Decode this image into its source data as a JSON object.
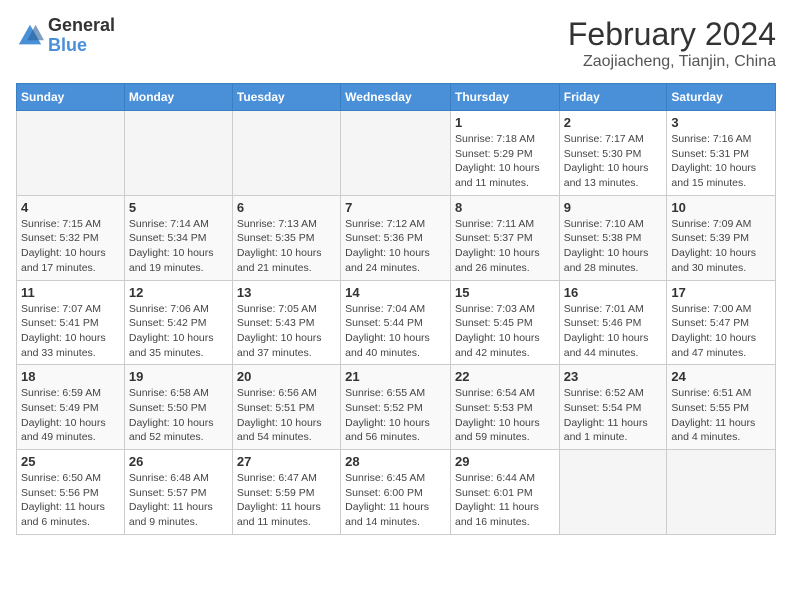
{
  "header": {
    "logo_general": "General",
    "logo_blue": "Blue",
    "month_title": "February 2024",
    "location": "Zaojiacheng, Tianjin, China"
  },
  "days_of_week": [
    "Sunday",
    "Monday",
    "Tuesday",
    "Wednesday",
    "Thursday",
    "Friday",
    "Saturday"
  ],
  "weeks": [
    [
      {
        "num": "",
        "detail": ""
      },
      {
        "num": "",
        "detail": ""
      },
      {
        "num": "",
        "detail": ""
      },
      {
        "num": "",
        "detail": ""
      },
      {
        "num": "1",
        "detail": "Sunrise: 7:18 AM\nSunset: 5:29 PM\nDaylight: 10 hours\nand 11 minutes."
      },
      {
        "num": "2",
        "detail": "Sunrise: 7:17 AM\nSunset: 5:30 PM\nDaylight: 10 hours\nand 13 minutes."
      },
      {
        "num": "3",
        "detail": "Sunrise: 7:16 AM\nSunset: 5:31 PM\nDaylight: 10 hours\nand 15 minutes."
      }
    ],
    [
      {
        "num": "4",
        "detail": "Sunrise: 7:15 AM\nSunset: 5:32 PM\nDaylight: 10 hours\nand 17 minutes."
      },
      {
        "num": "5",
        "detail": "Sunrise: 7:14 AM\nSunset: 5:34 PM\nDaylight: 10 hours\nand 19 minutes."
      },
      {
        "num": "6",
        "detail": "Sunrise: 7:13 AM\nSunset: 5:35 PM\nDaylight: 10 hours\nand 21 minutes."
      },
      {
        "num": "7",
        "detail": "Sunrise: 7:12 AM\nSunset: 5:36 PM\nDaylight: 10 hours\nand 24 minutes."
      },
      {
        "num": "8",
        "detail": "Sunrise: 7:11 AM\nSunset: 5:37 PM\nDaylight: 10 hours\nand 26 minutes."
      },
      {
        "num": "9",
        "detail": "Sunrise: 7:10 AM\nSunset: 5:38 PM\nDaylight: 10 hours\nand 28 minutes."
      },
      {
        "num": "10",
        "detail": "Sunrise: 7:09 AM\nSunset: 5:39 PM\nDaylight: 10 hours\nand 30 minutes."
      }
    ],
    [
      {
        "num": "11",
        "detail": "Sunrise: 7:07 AM\nSunset: 5:41 PM\nDaylight: 10 hours\nand 33 minutes."
      },
      {
        "num": "12",
        "detail": "Sunrise: 7:06 AM\nSunset: 5:42 PM\nDaylight: 10 hours\nand 35 minutes."
      },
      {
        "num": "13",
        "detail": "Sunrise: 7:05 AM\nSunset: 5:43 PM\nDaylight: 10 hours\nand 37 minutes."
      },
      {
        "num": "14",
        "detail": "Sunrise: 7:04 AM\nSunset: 5:44 PM\nDaylight: 10 hours\nand 40 minutes."
      },
      {
        "num": "15",
        "detail": "Sunrise: 7:03 AM\nSunset: 5:45 PM\nDaylight: 10 hours\nand 42 minutes."
      },
      {
        "num": "16",
        "detail": "Sunrise: 7:01 AM\nSunset: 5:46 PM\nDaylight: 10 hours\nand 44 minutes."
      },
      {
        "num": "17",
        "detail": "Sunrise: 7:00 AM\nSunset: 5:47 PM\nDaylight: 10 hours\nand 47 minutes."
      }
    ],
    [
      {
        "num": "18",
        "detail": "Sunrise: 6:59 AM\nSunset: 5:49 PM\nDaylight: 10 hours\nand 49 minutes."
      },
      {
        "num": "19",
        "detail": "Sunrise: 6:58 AM\nSunset: 5:50 PM\nDaylight: 10 hours\nand 52 minutes."
      },
      {
        "num": "20",
        "detail": "Sunrise: 6:56 AM\nSunset: 5:51 PM\nDaylight: 10 hours\nand 54 minutes."
      },
      {
        "num": "21",
        "detail": "Sunrise: 6:55 AM\nSunset: 5:52 PM\nDaylight: 10 hours\nand 56 minutes."
      },
      {
        "num": "22",
        "detail": "Sunrise: 6:54 AM\nSunset: 5:53 PM\nDaylight: 10 hours\nand 59 minutes."
      },
      {
        "num": "23",
        "detail": "Sunrise: 6:52 AM\nSunset: 5:54 PM\nDaylight: 11 hours\nand 1 minute."
      },
      {
        "num": "24",
        "detail": "Sunrise: 6:51 AM\nSunset: 5:55 PM\nDaylight: 11 hours\nand 4 minutes."
      }
    ],
    [
      {
        "num": "25",
        "detail": "Sunrise: 6:50 AM\nSunset: 5:56 PM\nDaylight: 11 hours\nand 6 minutes."
      },
      {
        "num": "26",
        "detail": "Sunrise: 6:48 AM\nSunset: 5:57 PM\nDaylight: 11 hours\nand 9 minutes."
      },
      {
        "num": "27",
        "detail": "Sunrise: 6:47 AM\nSunset: 5:59 PM\nDaylight: 11 hours\nand 11 minutes."
      },
      {
        "num": "28",
        "detail": "Sunrise: 6:45 AM\nSunset: 6:00 PM\nDaylight: 11 hours\nand 14 minutes."
      },
      {
        "num": "29",
        "detail": "Sunrise: 6:44 AM\nSunset: 6:01 PM\nDaylight: 11 hours\nand 16 minutes."
      },
      {
        "num": "",
        "detail": ""
      },
      {
        "num": "",
        "detail": ""
      }
    ]
  ]
}
